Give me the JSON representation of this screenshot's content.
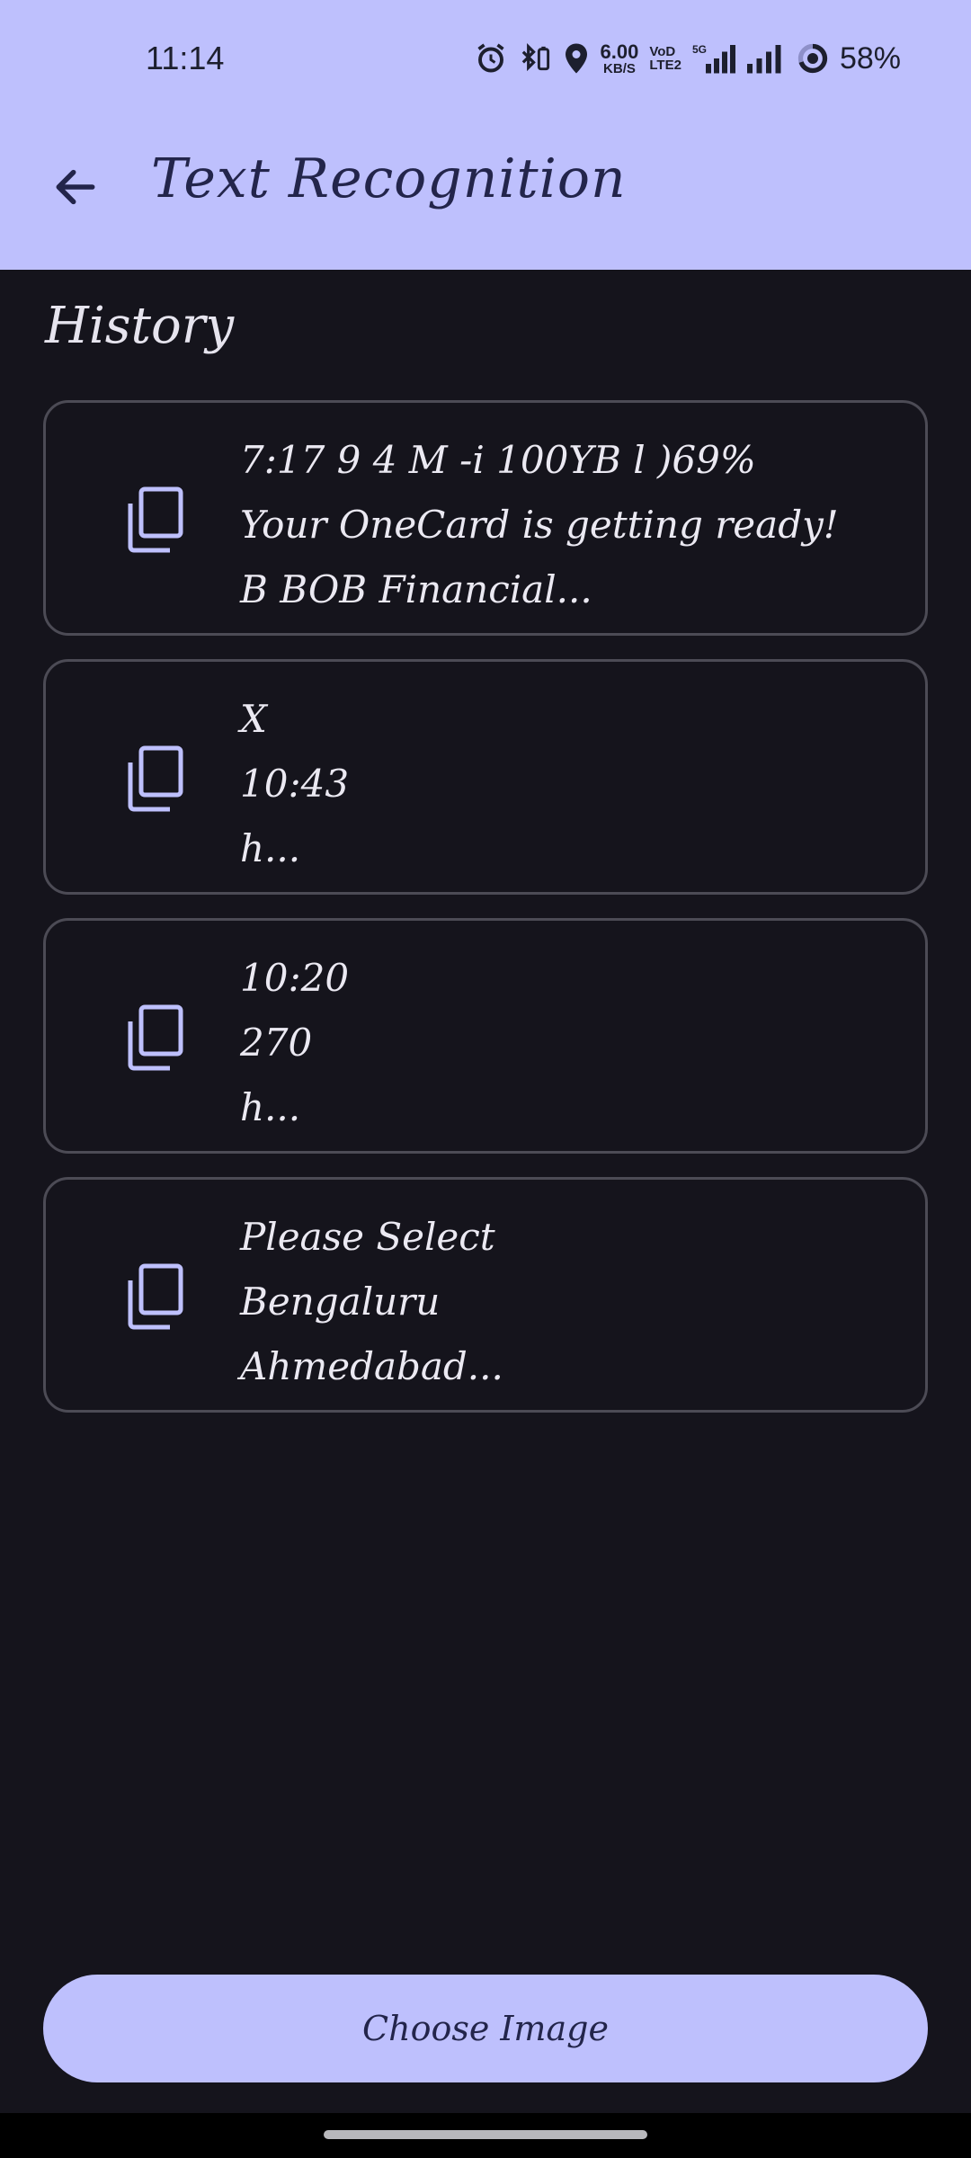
{
  "status_bar": {
    "time": "11:14",
    "net_speed_value": "6.00",
    "net_speed_unit": "KB/S",
    "volte_line1": "VoD",
    "volte_line2": "LTE2",
    "network_type": "5G",
    "battery_percent": "58%",
    "icons": [
      "alarm-icon",
      "bluetooth-battery-icon",
      "location-icon",
      "signal-icon",
      "signal-icon",
      "battery-ring-icon"
    ]
  },
  "app_bar": {
    "title": "Text Recognition",
    "back_icon": "arrow-back-icon"
  },
  "history": {
    "title": "History",
    "items": [
      {
        "lines": [
          "7:17 9 4 M -i 100YB l )69%",
          "Your OneCard is getting ready!",
          "B BOB Financial..."
        ]
      },
      {
        "lines": [
          "X",
          "10:43",
          "h..."
        ]
      },
      {
        "lines": [
          "10:20",
          "270",
          "h..."
        ]
      },
      {
        "lines": [
          "Please Select",
          "Bengaluru",
          "Ahmedabad..."
        ]
      }
    ]
  },
  "choose_button": {
    "label": "Choose Image"
  },
  "colors": {
    "accent": "#bec0fd",
    "background": "#15141c",
    "card_border": "#4c4b55",
    "title_text": "#23254b"
  }
}
